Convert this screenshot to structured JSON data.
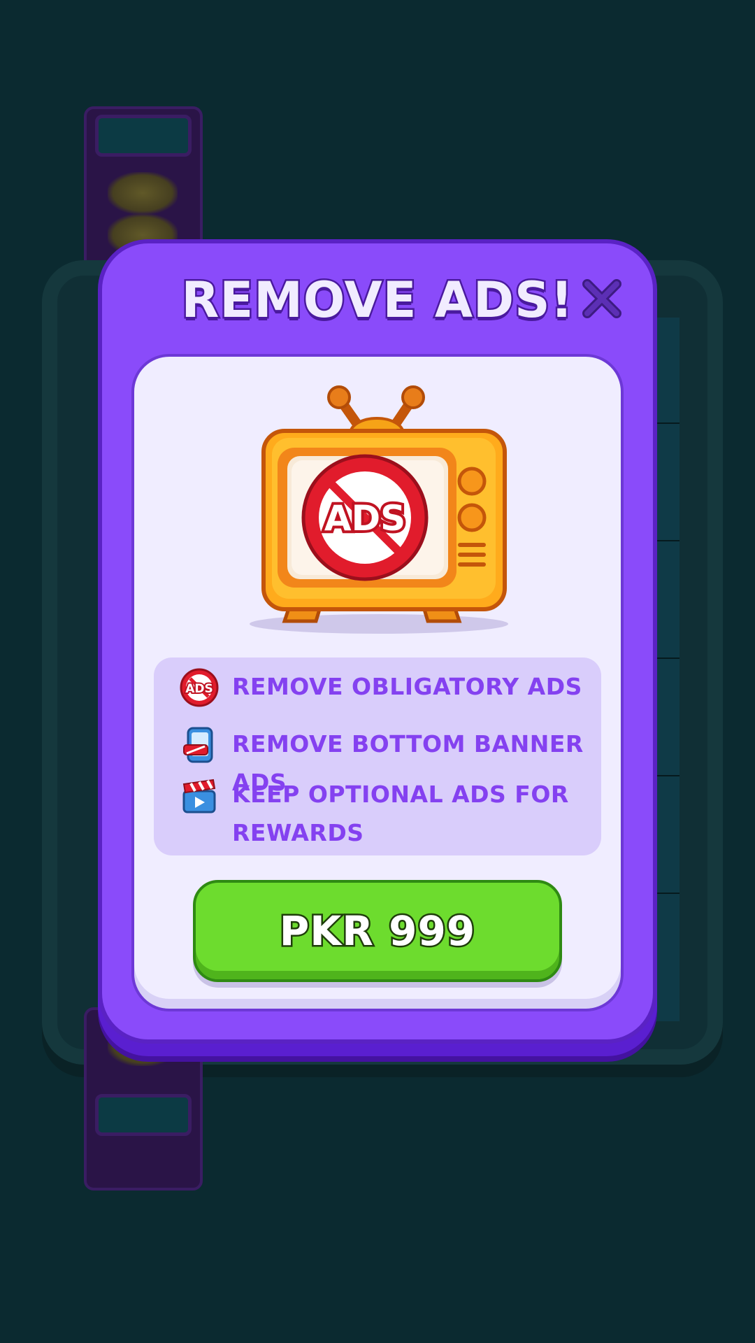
{
  "dialog": {
    "title": "REMOVE ADS!",
    "close_label": "×"
  },
  "illustration": {
    "screen_badge_text": "ADS",
    "icon": "tv-no-ads-icon"
  },
  "features": [
    {
      "icon": "no-ads-badge-icon",
      "text": "REMOVE OBLIGATORY ADS"
    },
    {
      "icon": "phone-banner-icon",
      "text": "REMOVE BOTTOM BANNER ADS"
    },
    {
      "icon": "video-clapper-icon",
      "text": "KEEP OPTIONAL ADS FOR REWARDS"
    }
  ],
  "purchase": {
    "price_label": "PKR 999"
  },
  "colors": {
    "modal": "#8a4bfa",
    "panel": "#f0edff",
    "feature_bg": "#d9cdfb",
    "feature_text": "#8441f0",
    "button": "#6ddc2e",
    "background": "#0b2a30"
  }
}
